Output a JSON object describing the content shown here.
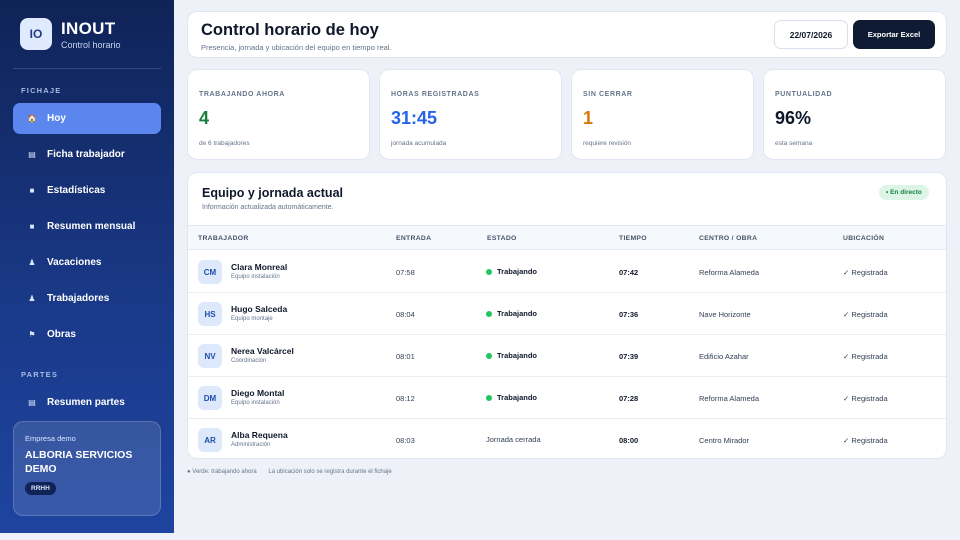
{
  "brand": {
    "logo": "IO",
    "name": "INOUT",
    "subtitle": "Control horario"
  },
  "sidebar": {
    "section_fichaje": "FICHAJE",
    "section_partes": "PARTES",
    "items": [
      {
        "label": "Hoy",
        "icon": "house-icon"
      },
      {
        "label": "Ficha trabajador",
        "icon": "id-card-icon"
      },
      {
        "label": "Estadísticas",
        "icon": "chart-icon"
      },
      {
        "label": "Resumen mensual",
        "icon": "calendar-icon"
      },
      {
        "label": "Vacaciones",
        "icon": "person-icon"
      },
      {
        "label": "Trabajadores",
        "icon": "person-icon"
      },
      {
        "label": "Obras",
        "icon": "flag-icon"
      }
    ],
    "partes_items": [
      {
        "label": "Resumen partes",
        "icon": "list-icon"
      }
    ],
    "company": {
      "label": "Empresa demo",
      "name": "ALBORIA SERVICIOS DEMO",
      "badge": "RRHH"
    }
  },
  "header": {
    "title": "Control horario de hoy",
    "subtitle": "Presencia, jornada y ubicación del equipo en tiempo real.",
    "date": "22/07/2026",
    "export_label": "Exportar Excel"
  },
  "stats": [
    {
      "label": "TRABAJANDO AHORA",
      "value": "4",
      "sub": "de 6 trabajadores",
      "color": "#15803d"
    },
    {
      "label": "HORAS REGISTRADAS",
      "value": "31:45",
      "sub": "jornada acumulada",
      "color": "#2563eb"
    },
    {
      "label": "SIN CERRAR",
      "value": "1",
      "sub": "requiere revisión",
      "color": "#d97706"
    },
    {
      "label": "PUNTUALIDAD",
      "value": "96%",
      "sub": "esta semana",
      "color": "#0f172a"
    }
  ],
  "team": {
    "title": "Equipo y jornada actual",
    "subtitle": "Información actualizada automáticamente.",
    "live_label": "• En directo",
    "columns": [
      "TRABAJADOR",
      "ENTRADA",
      "ESTADO",
      "TIEMPO",
      "CENTRO / OBRA",
      "UBICACIÓN"
    ],
    "rows": [
      {
        "initials": "CM",
        "name": "Clara Monreal",
        "team": "Equipo instalación",
        "entrada": "07:58",
        "estado": "Trabajando",
        "working": true,
        "tiempo": "07:42",
        "centro": "Reforma Alameda",
        "ubicacion": "✓ Registrada"
      },
      {
        "initials": "HS",
        "name": "Hugo Salceda",
        "team": "Equipo montaje",
        "entrada": "08:04",
        "estado": "Trabajando",
        "working": true,
        "tiempo": "07:36",
        "centro": "Nave Horizonte",
        "ubicacion": "✓ Registrada"
      },
      {
        "initials": "NV",
        "name": "Nerea Valcárcel",
        "team": "Coordinación",
        "entrada": "08:01",
        "estado": "Trabajando",
        "working": true,
        "tiempo": "07:39",
        "centro": "Edificio Azahar",
        "ubicacion": "✓ Registrada"
      },
      {
        "initials": "DM",
        "name": "Diego Montal",
        "team": "Equipo instalación",
        "entrada": "08:12",
        "estado": "Trabajando",
        "working": true,
        "tiempo": "07:28",
        "centro": "Reforma Alameda",
        "ubicacion": "✓ Registrada"
      },
      {
        "initials": "AR",
        "name": "Alba Requena",
        "team": "Administración",
        "entrada": "08:03",
        "estado": "Jornada cerrada",
        "working": false,
        "tiempo": "08:00",
        "centro": "Centro Mirador",
        "ubicacion": "✓ Registrada"
      }
    ]
  },
  "footer": {
    "legend": "● Verde: trabajando ahora",
    "note": "La ubicación solo se registra durante el fichaje"
  }
}
